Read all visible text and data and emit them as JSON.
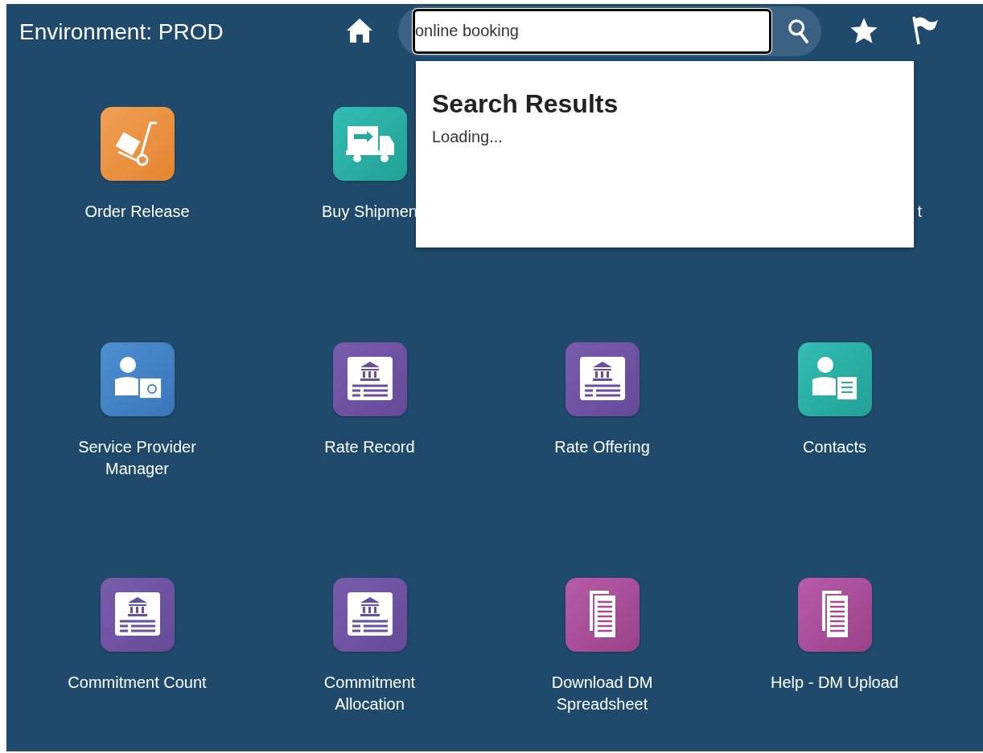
{
  "header": {
    "title": "Environment: PROD"
  },
  "search": {
    "value": "online booking"
  },
  "search_results": {
    "title": "Search Results",
    "status": "Loading..."
  },
  "rows": [
    [
      {
        "label": "Order Release",
        "kind": "dolly"
      },
      {
        "label": "Buy Shipmen",
        "kind": "truck"
      },
      {
        "label": "t",
        "kind": "covered"
      }
    ],
    [
      {
        "label": "Service Provider Manager",
        "kind": "person-certificate"
      },
      {
        "label": "Rate Record",
        "kind": "bank"
      },
      {
        "label": "Rate Offering",
        "kind": "bank"
      },
      {
        "label": "Contacts",
        "kind": "person-document"
      }
    ],
    [
      {
        "label": "Commitment Count",
        "kind": "bank"
      },
      {
        "label": "Commitment Allocation",
        "kind": "bank"
      },
      {
        "label": "Download DM Spreadsheet",
        "kind": "documents"
      },
      {
        "label": "Help - DM Upload",
        "kind": "documents"
      }
    ]
  ]
}
